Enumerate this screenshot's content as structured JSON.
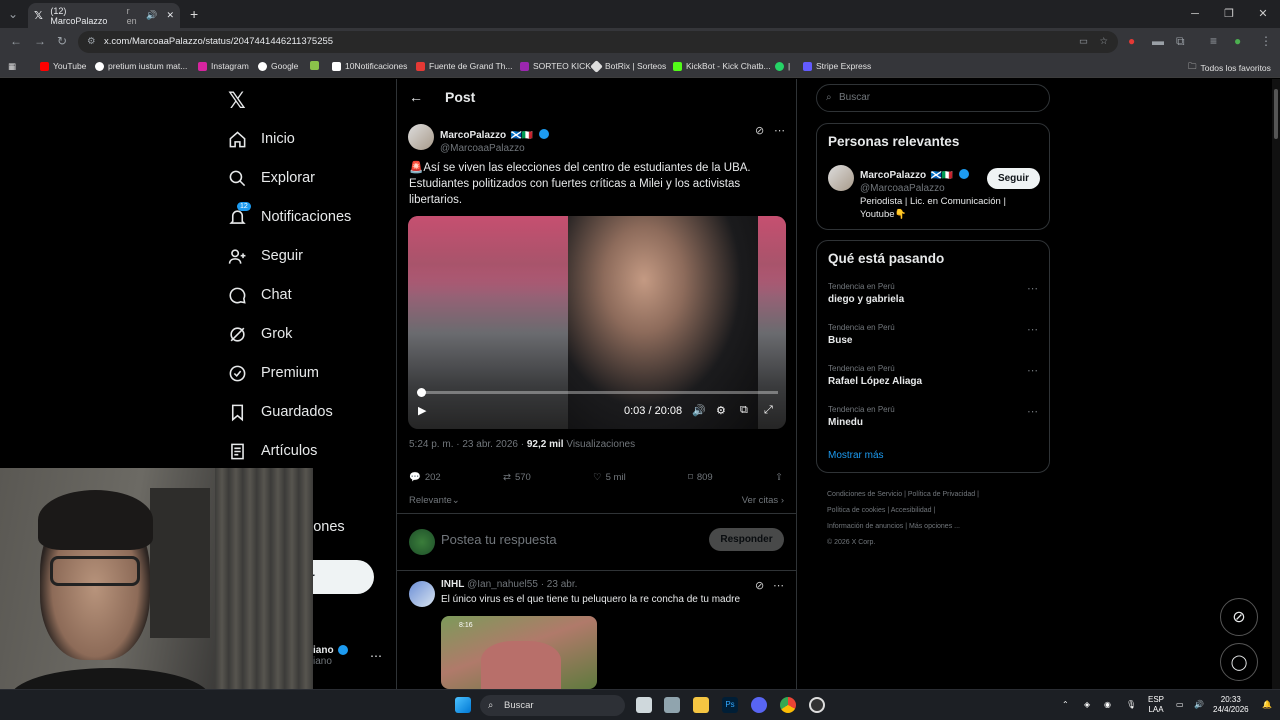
{
  "browser": {
    "tab_title": "(12) MarcoPalazzo",
    "tab_suffix": "r en",
    "url": "x.com/MarcoaaPalazzo/status/2047441446211375255",
    "bookmarks": [
      "YouTube",
      "pretium iustum mat...",
      "Instagram",
      "Google",
      "10Notificaciones",
      "Fuente de Grand Th...",
      "SORTEO KICK",
      "BotRix | Sorteos",
      "KickBot - Kick Chatb...",
      "|",
      "Stripe Express"
    ],
    "all_bookmarks": "Todos los favoritos"
  },
  "nav": {
    "items": [
      "Inicio",
      "Explorar",
      "Notificaciones",
      "Seguir",
      "Chat",
      "Grok",
      "Premium",
      "Guardados",
      "Artículos"
    ],
    "notif_count": "12",
    "partial_item": "iones",
    "partial_button": "r",
    "partial_user": "iano",
    "partial_user_handle": "iano"
  },
  "post": {
    "header": "Post",
    "author_name": "MarcoPalazzo",
    "author_flags": "🏴󠁧󠁢󠁳󠁣󠁴󠁿🇮🇹",
    "author_handle": "@MarcoaaPalazzo",
    "text": "🚨Así se viven las elecciones del centro de estudiantes de la UBA. Estudiantes politizados con fuertes críticas a Milei y los activistas libertarios.",
    "video_time": "0:03 / 20:08",
    "video_progress": 0.0025,
    "timestamp": "5:24 p. m. · 23 abr. 2026 ·",
    "views_count": "92,2 mil",
    "views_label": "Visualizaciones",
    "replies": "202",
    "reposts": "570",
    "likes": "5 mil",
    "bookmarks": "809",
    "sort_label": "Relevante",
    "quotes_label": "Ver citas",
    "reply_placeholder": "Postea tu respuesta",
    "reply_button": "Responder"
  },
  "reply": {
    "name": "INHL",
    "handle": "@Ian_nahuel55",
    "date": "· 23 abr.",
    "text": "El único virus es el que tiene tu peluquero la re concha de tu madre",
    "thumb_time": "8:16"
  },
  "sidebar": {
    "search_placeholder": "Buscar",
    "relevant_title": "Personas relevantes",
    "person_name": "MarcoPalazzo",
    "person_handle": "@MarcoaaPalazzo",
    "person_bio": "Periodista | Lic. en Comunicación | Youtube👇",
    "follow_label": "Seguir",
    "trends_title": "Qué está pasando",
    "trends": [
      {
        "category": "Tendencia en Perú",
        "name": "diego y gabriela"
      },
      {
        "category": "Tendencia en Perú",
        "name": "Buse"
      },
      {
        "category": "Tendencia en Perú",
        "name": "Rafael López Aliaga"
      },
      {
        "category": "Tendencia en Perú",
        "name": "Minedu"
      }
    ],
    "show_more": "Mostrar más",
    "footer": [
      "Condiciones de Servicio",
      "|",
      "Política de Privacidad",
      "|",
      "Política de cookies",
      "|",
      "Accesibilidad",
      "|",
      "Información de anuncios",
      "|",
      "Más opciones ...",
      "© 2026 X Corp."
    ]
  },
  "taskbar": {
    "search": "Buscar",
    "lang1": "ESP",
    "lang2": "LAA",
    "time": "20:33",
    "date": "24/4/2026"
  }
}
